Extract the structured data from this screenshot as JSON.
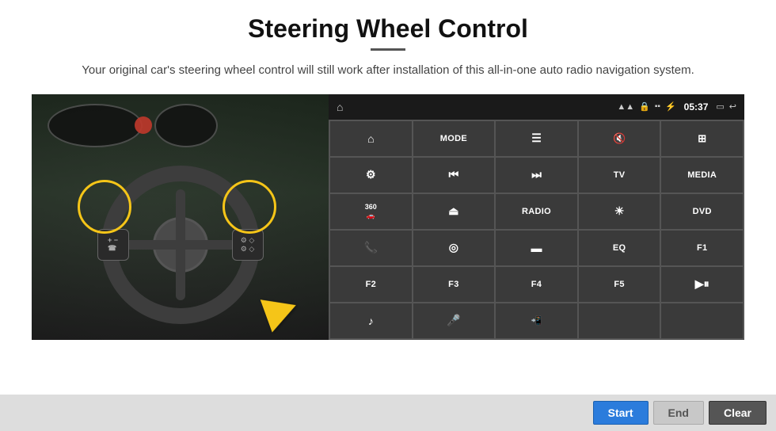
{
  "header": {
    "title": "Steering Wheel Control",
    "subtitle": "Your original car's steering wheel control will still work after installation of this all-in-one auto radio navigation system."
  },
  "statusBar": {
    "time": "05:37",
    "icons": [
      "wifi",
      "lock",
      "sim",
      "bluetooth",
      "battery",
      "window",
      "back"
    ]
  },
  "gridButtons": [
    {
      "id": "r1c1",
      "icon": "home",
      "label": "",
      "type": "icon"
    },
    {
      "id": "r1c2",
      "icon": "",
      "label": "MODE",
      "type": "text"
    },
    {
      "id": "r1c3",
      "icon": "list",
      "label": "",
      "type": "icon"
    },
    {
      "id": "r1c4",
      "icon": "mute",
      "label": "",
      "type": "icon"
    },
    {
      "id": "r1c5",
      "icon": "apps",
      "label": "",
      "type": "icon"
    },
    {
      "id": "r2c1",
      "icon": "settings",
      "label": "",
      "type": "icon"
    },
    {
      "id": "r2c2",
      "icon": "prev",
      "label": "",
      "type": "icon"
    },
    {
      "id": "r2c3",
      "icon": "next",
      "label": "",
      "type": "icon"
    },
    {
      "id": "r2c4",
      "icon": "",
      "label": "TV",
      "type": "text"
    },
    {
      "id": "r2c5",
      "icon": "",
      "label": "MEDIA",
      "type": "text"
    },
    {
      "id": "r3c1",
      "icon": "car360",
      "label": "",
      "type": "icon"
    },
    {
      "id": "r3c2",
      "icon": "eject",
      "label": "",
      "type": "icon"
    },
    {
      "id": "r3c3",
      "icon": "",
      "label": "RADIO",
      "type": "text"
    },
    {
      "id": "r3c4",
      "icon": "sun",
      "label": "",
      "type": "icon"
    },
    {
      "id": "r3c5",
      "icon": "",
      "label": "DVD",
      "type": "text"
    },
    {
      "id": "r4c1",
      "icon": "phone",
      "label": "",
      "type": "icon"
    },
    {
      "id": "r4c2",
      "icon": "swirl",
      "label": "",
      "type": "icon"
    },
    {
      "id": "r4c3",
      "icon": "rect",
      "label": "",
      "type": "icon"
    },
    {
      "id": "r4c4",
      "icon": "",
      "label": "EQ",
      "type": "text"
    },
    {
      "id": "r4c5",
      "icon": "",
      "label": "F1",
      "type": "text"
    },
    {
      "id": "r5c1",
      "icon": "",
      "label": "F2",
      "type": "text"
    },
    {
      "id": "r5c2",
      "icon": "",
      "label": "F3",
      "type": "text"
    },
    {
      "id": "r5c3",
      "icon": "",
      "label": "F4",
      "type": "text"
    },
    {
      "id": "r5c4",
      "icon": "",
      "label": "F5",
      "type": "text"
    },
    {
      "id": "r5c5",
      "icon": "playpause",
      "label": "",
      "type": "icon"
    },
    {
      "id": "r6c1",
      "icon": "music",
      "label": "",
      "type": "icon"
    },
    {
      "id": "r6c2",
      "icon": "mic",
      "label": "",
      "type": "icon"
    },
    {
      "id": "r6c3",
      "icon": "call",
      "label": "",
      "type": "icon"
    },
    {
      "id": "r6c4",
      "icon": "",
      "label": "",
      "type": "empty"
    },
    {
      "id": "r6c5",
      "icon": "",
      "label": "",
      "type": "empty"
    }
  ],
  "bottomBar": {
    "startLabel": "Start",
    "endLabel": "End",
    "clearLabel": "Clear"
  },
  "colors": {
    "panelBg": "#2b2b2b",
    "btnBg": "#3a3a3a",
    "statusBg": "#1a1a1a",
    "startBtn": "#2b7cdc",
    "endBtn": "#c8c8c8",
    "clearBtn": "#555555"
  }
}
